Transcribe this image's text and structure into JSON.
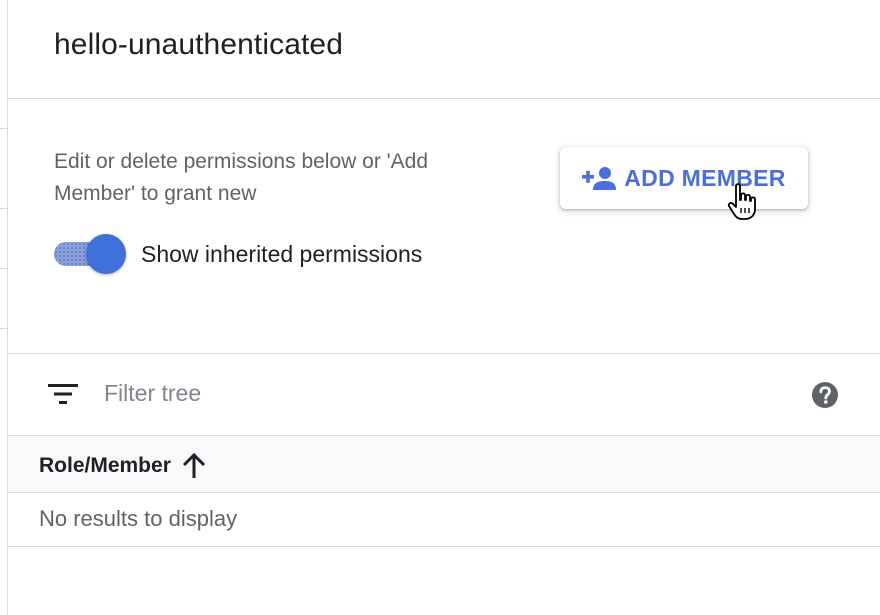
{
  "panel": {
    "title": "hello-unauthenticated",
    "description": "Edit or delete permissions below or 'Add Member' to grant new",
    "add_member_label": "ADD MEMBER",
    "add_member_icon": "person-add-icon"
  },
  "inherited_toggle": {
    "label": "Show inherited permissions",
    "on": true
  },
  "filter": {
    "icon": "filter-list-icon",
    "placeholder": "Filter tree",
    "value": "",
    "help_icon": "help-icon"
  },
  "table": {
    "columns": [
      {
        "label": "Role/Member",
        "sort": "ascending",
        "sort_icon": "arrow-upward-icon"
      }
    ],
    "empty_text": "No results to display"
  },
  "colors": {
    "accent": "#4a6fd6",
    "toggle_thumb": "#3f6fd8",
    "divider": "#dadce0",
    "header_bg": "#f8f9fa"
  }
}
